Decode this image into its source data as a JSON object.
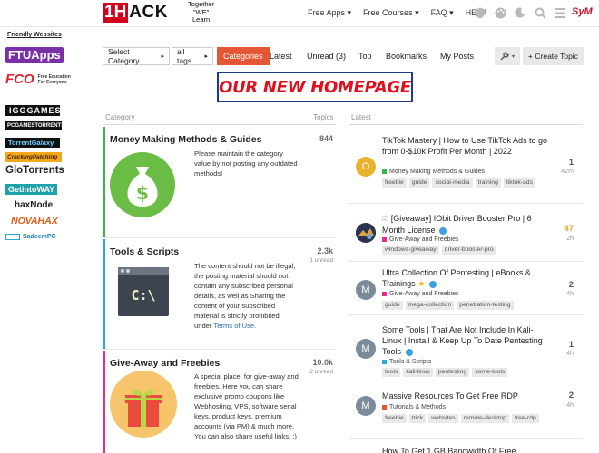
{
  "header": {
    "logo_box": "1H",
    "logo_text": "ACK",
    "tagline": [
      "Together",
      "\"WE\"",
      "Learn"
    ],
    "nav": [
      "Free Apps ▾",
      "Free Courses ▾",
      "FAQ ▾",
      "HELP"
    ],
    "icons": [
      "shield-icon",
      "palette-icon",
      "moon-icon",
      "search-icon",
      "menu-icon"
    ],
    "avatar": "SyM"
  },
  "sidebar": {
    "title": "Friendly Websites",
    "sites": [
      "FTUApps",
      "FCO",
      "IGGGAMES",
      "PCGAMESTORRENTS",
      "TorrentGalaxy",
      "CrackingPatching",
      "GloTorrents",
      "GetintoWAY",
      "haxNode",
      "NOVAHAX",
      "SadeemPC"
    ],
    "fco_sub": "Free Education For Everyone"
  },
  "controls": {
    "select_category": "Select Category",
    "all_tags": "all tags",
    "tabs": [
      "Categories",
      "Latest",
      "Unread (3)",
      "Top",
      "Bookmarks",
      "My Posts"
    ],
    "create_topic": "+ Create Topic"
  },
  "banner": "OUR NEW HOMEPAGE",
  "columns": {
    "category": "Category",
    "topics": "Topics",
    "latest": "Latest"
  },
  "categories": [
    {
      "name": "Money Making Methods & Guides",
      "desc": "Please maintain the category value by not posting any outdated methods!",
      "count": "844",
      "unread": "",
      "color": "#3ab54a"
    },
    {
      "name": "Tools & Scripts",
      "desc": "The content should not be illegal, the posting material should not contain any subscribed personal details, as well as Sharing the content of your subscribed material is strictly prohibited under",
      "desc_link": "Terms of Use.",
      "count": "2.3k",
      "unread": "1 unread",
      "color": "#25aae1"
    },
    {
      "name": "Give-Away and Freebies",
      "desc": "A special place, for give-away and freebies. Here you can share exclusive promo coupons like Webhosting, VPS, software serial keys, product keys, premium accounts (via PM) & much more. You can also share useful links. :)",
      "count": "10.0k",
      "unread": "2 unread",
      "color": "#e52e8a"
    }
  ],
  "latest": [
    {
      "avatar": "O",
      "avatar_color": "#e8b42f",
      "title": "TikTok Mastery | How to Use TikTok Ads to go from 0-$10k Profit Per Month | 2022",
      "category": "Money Making Methods & Guides",
      "cat_color": "#3ab54a",
      "tags": [
        "freebie",
        "guide",
        "social-media",
        "training",
        "tiktok-ads"
      ],
      "num": "1",
      "age": "42m"
    },
    {
      "avatar": "",
      "avatar_color": "#3a4a6a",
      "title": "[Giveaway] IObit Driver Booster Pro | 6 Month License",
      "category": "Give-Away and Freebies",
      "cat_color": "#e52e8a",
      "tags": [
        "windows-giveaway",
        "driver-booster-pro"
      ],
      "num": "47",
      "age": "2h"
    },
    {
      "avatar": "M",
      "avatar_color": "#7c8b9a",
      "title": "Ultra Collection Of Pentesting | eBooks & Trainings",
      "category": "Give-Away and Freebies",
      "cat_color": "#e52e8a",
      "tags": [
        "guide",
        "mega-collection",
        "penetration-testing"
      ],
      "num": "2",
      "age": "4h"
    },
    {
      "avatar": "M",
      "avatar_color": "#7c8b9a",
      "title": "Some Tools | That Are Not Include In Kali-Linux | Install & Keep Up To Date Pentesting Tools",
      "category": "Tools & Scripts",
      "cat_color": "#25aae1",
      "tags": [
        "tools",
        "kali-linux",
        "pentesting",
        "some-tools"
      ],
      "num": "1",
      "age": "4h"
    },
    {
      "avatar": "M",
      "avatar_color": "#7c8b9a",
      "title": "Massive Resources To Get Free RDP",
      "category": "Tutorials & Methods",
      "cat_color": "#e45735",
      "tags": [
        "freebie",
        "trick",
        "websites",
        "remote-desktop",
        "free-rdp"
      ],
      "num": "2",
      "age": "4h"
    },
    {
      "title": "How To Get 1 GB Bandwidth Of Free"
    }
  ]
}
